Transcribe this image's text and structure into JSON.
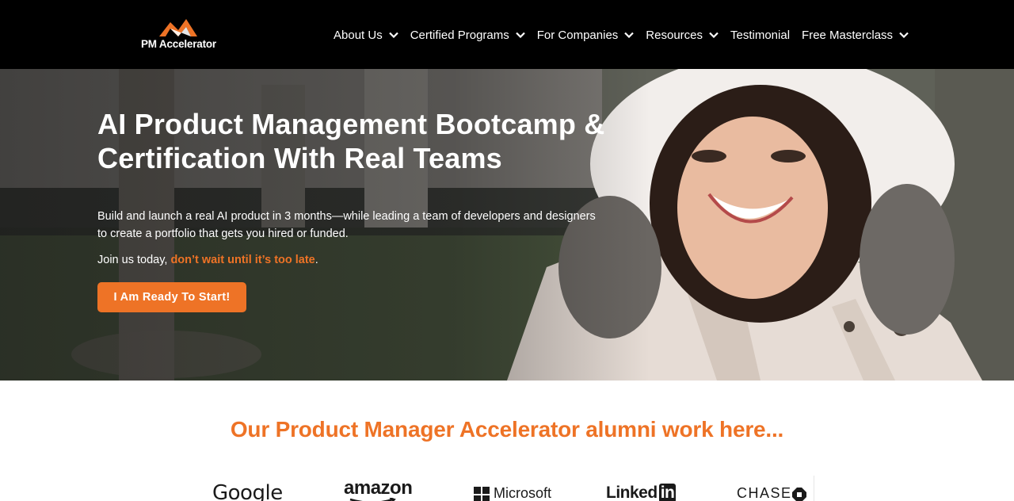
{
  "brand": {
    "name": "PM Accelerator",
    "accent_color": "#ee7326",
    "header_bg": "#000000",
    "logo_icon": "mountain-peak-logo"
  },
  "nav": {
    "items": [
      {
        "label": "About Us",
        "dropdown": true
      },
      {
        "label": "Certified Programs",
        "dropdown": true
      },
      {
        "label": "For Companies",
        "dropdown": true
      },
      {
        "label": "Resources",
        "dropdown": true
      },
      {
        "label": "Testimonial",
        "dropdown": false
      },
      {
        "label": "Free Masterclass",
        "dropdown": true
      }
    ],
    "dropdown_icon": "chevron-down-icon"
  },
  "hero": {
    "title": "AI Product Management Bootcamp & Certification With Real Teams",
    "description": "Build and launch a real AI product in 3 months—while leading a team of developers and designers to create a portfolio that gets you hired or funded.",
    "join_prefix": "Join us today, ",
    "join_highlight": "don’t wait until it’s too late",
    "join_suffix": ".",
    "cta_label": "I Am Ready To Start!"
  },
  "alumni": {
    "heading": "Our Product Manager Accelerator alumni work here...",
    "companies": [
      "Google",
      "amazon",
      "Microsoft",
      "Linked",
      "in",
      "CHASE"
    ]
  }
}
